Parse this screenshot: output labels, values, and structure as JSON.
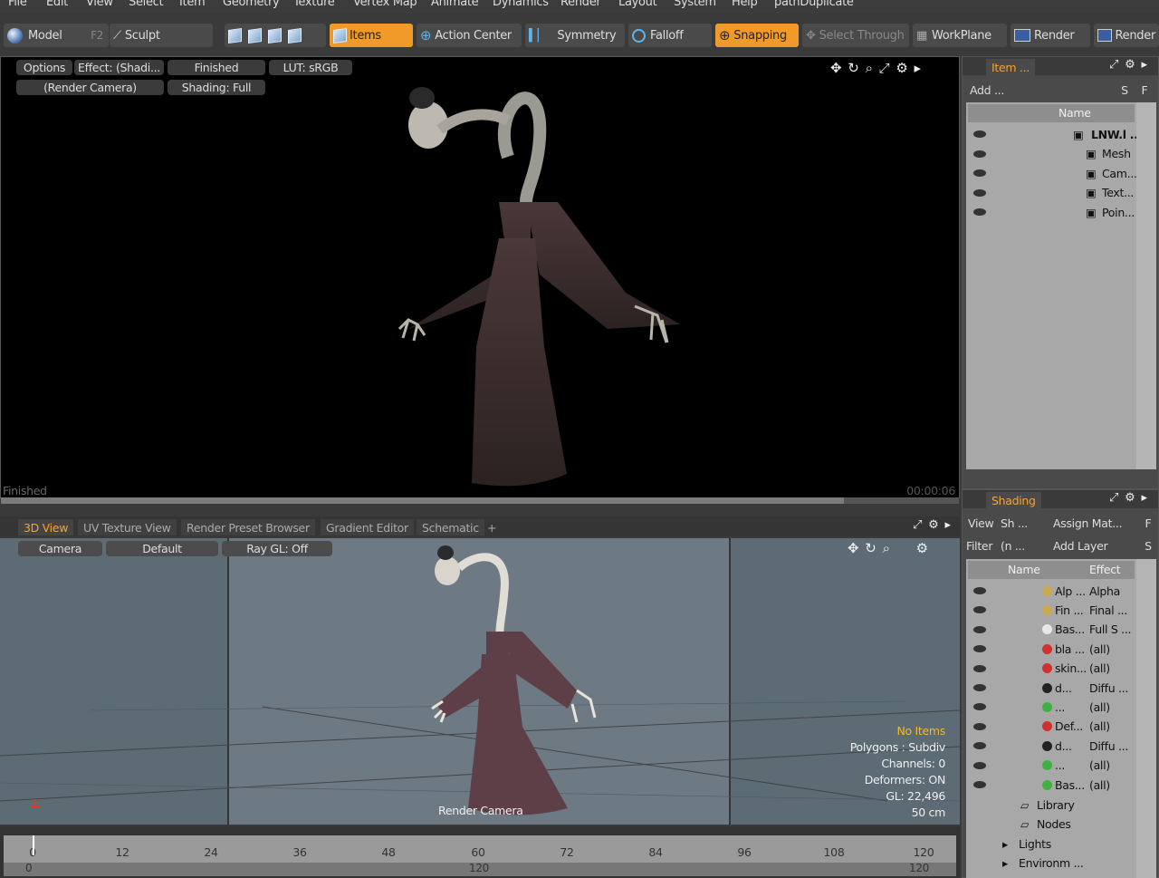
{
  "menu": [
    "File",
    "Edit",
    "View",
    "Select",
    "Item",
    "Geometry",
    "Texture",
    "Vertex Map",
    "Animate",
    "Dynamics",
    "Render",
    "Layout",
    "System",
    "Help",
    "pathDuplicate"
  ],
  "toolbar": {
    "model": "Model",
    "model_key": "F2",
    "sculpt": "Sculpt",
    "items": "Items",
    "action_center": "Action Center",
    "symmetry": "Symmetry",
    "falloff": "Falloff",
    "snapping": "Snapping",
    "select_through": "Select Through",
    "workplane": "WorkPlane",
    "render": "Render",
    "render2": "Render"
  },
  "render_view": {
    "options": "Options",
    "effect": "Effect: (Shadi...",
    "status_pill": "Finished",
    "lut": "LUT: sRGB",
    "camera": "(Render Camera)",
    "shading": "Shading: Full",
    "status": "Finished",
    "time": "00:00:06"
  },
  "tabs": [
    "3D View",
    "UV Texture View",
    "Render Preset Browser",
    "Gradient Editor",
    "Schematic",
    "+"
  ],
  "view3d": {
    "camera": "Camera",
    "default": "Default",
    "raygl": "Ray GL: Off",
    "info": [
      "No Items",
      "Polygons : Subdiv",
      "Channels: 0",
      "Deformers: ON",
      "GL: 22,496",
      "50 cm"
    ],
    "render_camera": "Render Camera"
  },
  "timeline": {
    "labels": [
      "0",
      "12",
      "24",
      "36",
      "48",
      "60",
      "72",
      "84",
      "96",
      "108",
      "120"
    ],
    "range_start": "0",
    "range_mid": "120",
    "range_end": "120"
  },
  "item_panel": {
    "tab": "Item ...",
    "add": "Add ...",
    "s": "S",
    "f": "F",
    "name_col": "Name",
    "items": [
      {
        "label": "LNW.l ...",
        "icon": "scene-icon",
        "indent": 0
      },
      {
        "label": "Mesh",
        "icon": "mesh-icon",
        "indent": 1
      },
      {
        "label": "Cam...",
        "icon": "camera-icon",
        "indent": 1
      },
      {
        "label": "Text...",
        "icon": "texture-icon",
        "indent": 1
      },
      {
        "label": "Poin...",
        "icon": "light-icon",
        "indent": 1
      }
    ]
  },
  "shading_panel": {
    "tab": "Shading",
    "view": "View",
    "view_sel": "Sh ...",
    "assign": "Assign Mat...",
    "f": "F",
    "filter": "Filter",
    "filter_sel": "(n ...",
    "add_layer": "Add Layer",
    "s": "S",
    "name_col": "Name",
    "effect_col": "Effect",
    "rows": [
      {
        "name": "Alp ...",
        "effect": "Alpha",
        "color": "#c8a850"
      },
      {
        "name": "Fin ...",
        "effect": "Final ...",
        "color": "#c8a850"
      },
      {
        "name": "Bas...",
        "effect": "Full S ...",
        "color": "#e8e8e8"
      },
      {
        "name": "bla ...",
        "effect": "(all)",
        "color": "#d03030"
      },
      {
        "name": "skin...",
        "effect": "(all)",
        "color": "#d03030"
      },
      {
        "name": "d...",
        "effect": "Diffu ...",
        "color": "#222222"
      },
      {
        "name": "...",
        "effect": "(all)",
        "color": "#40b040"
      },
      {
        "name": "Def...",
        "effect": "(all)",
        "color": "#d03030"
      },
      {
        "name": "d...",
        "effect": "Diffu ...",
        "color": "#222222"
      },
      {
        "name": "...",
        "effect": "(all)",
        "color": "#40b040"
      },
      {
        "name": "Bas...",
        "effect": "(all)",
        "color": "#40b040"
      }
    ],
    "folders": [
      "Library",
      "Nodes",
      "Lights",
      "Environm ..."
    ]
  }
}
